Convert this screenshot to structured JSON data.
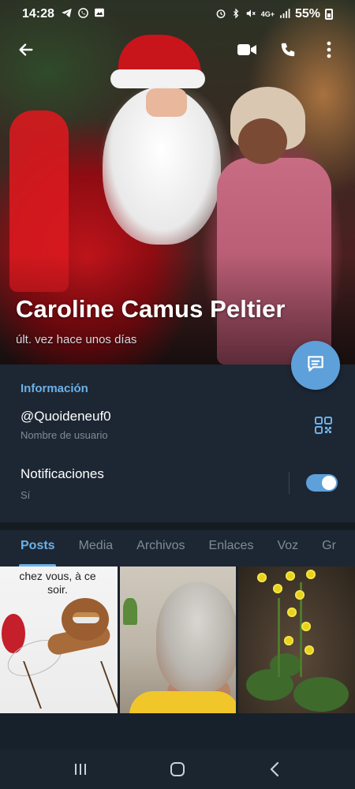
{
  "status_bar": {
    "time": "14:28",
    "left_icons": [
      "telegram-icon",
      "whatsapp-icon",
      "gallery-icon"
    ],
    "network": "4G+",
    "battery": "55%"
  },
  "profile": {
    "name": "Caroline Camus Peltier",
    "last_seen": "últ. vez hace unos días"
  },
  "info": {
    "title": "Información",
    "username": "@Quoideneuf0",
    "username_label": "Nombre de usuario",
    "notifications_label": "Notificaciones",
    "notifications_value": "Sí",
    "notifications_on": true
  },
  "tabs": [
    {
      "label": "Posts",
      "active": true
    },
    {
      "label": "Media",
      "active": false
    },
    {
      "label": "Archivos",
      "active": false
    },
    {
      "label": "Enlaces",
      "active": false
    },
    {
      "label": "Voz",
      "active": false
    },
    {
      "label": "Gr",
      "active": false
    }
  ],
  "media": {
    "thumb1_caption": "chez vous, à ce soir."
  },
  "colors": {
    "accent": "#5ea0d9",
    "accent_text": "#6cb0e8",
    "background": "#17212b",
    "panel": "#1d2733"
  }
}
